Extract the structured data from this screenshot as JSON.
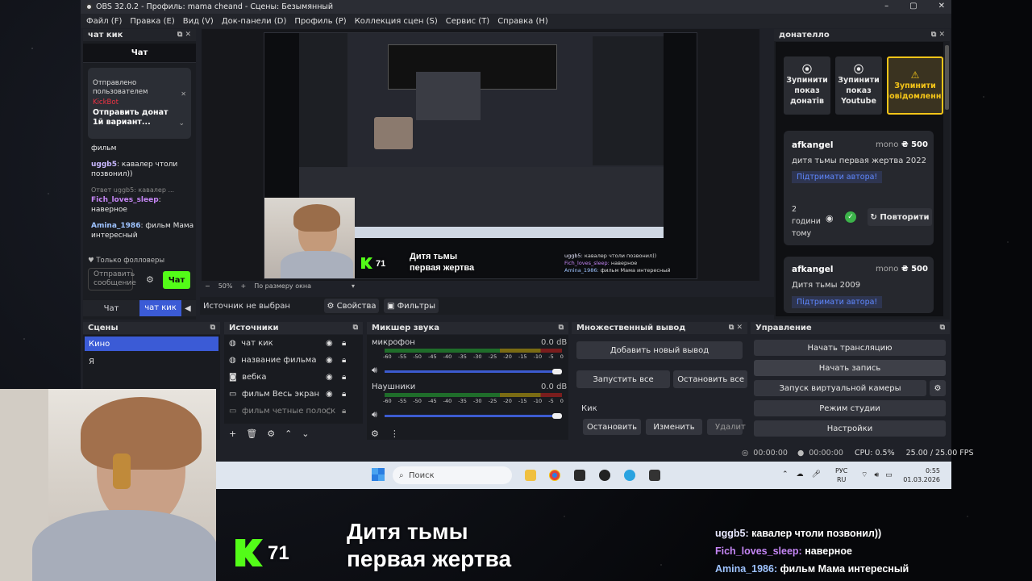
{
  "window": {
    "title": "OBS 32.0.2 - Профиль: mama cheand - Сцены: Безымянный",
    "controls": [
      "–",
      "▢",
      "✕"
    ]
  },
  "menu": [
    "Файл (F)",
    "Правка (E)",
    "Вид (V)",
    "Док-панели (D)",
    "Профиль (P)",
    "Коллекция сцен (S)",
    "Сервис (T)",
    "Справка (H)"
  ],
  "chat_dock": {
    "title": "чат кик",
    "header": "Чат",
    "pinned_label": "Отправлено пользователем",
    "pinned_user": "KickBot",
    "pinned_text": "Отправить донат 1й вариант...",
    "messages": [
      {
        "user": "",
        "text": "фильм"
      },
      {
        "user": "uggb5",
        "text": ": кавалер чтоли позвонил))"
      },
      {
        "reply": "Ответ uggb5: кавалер ...",
        "user": "Fich_loves_sleep",
        "text": ": наверное"
      },
      {
        "user": "Amina_1986",
        "text": ": фильм Мама интересный"
      }
    ],
    "followers_only": "Только фолловеры",
    "input_placeholder": "Отправить сообщение",
    "send_button": "Чат",
    "tabs": [
      "Чат",
      "чат кик"
    ]
  },
  "preview": {
    "zoom": "50%",
    "fit": "По размеру окна",
    "no_source": "Источник не выбран",
    "properties": "Свойства",
    "filters": "Фильтры",
    "overlay_count": "71",
    "overlay_title_1": "Дитя тьмы",
    "overlay_title_2": "первая жертва"
  },
  "donatello": {
    "title": "донателло",
    "buttons": [
      "Зупинити показ донатів",
      "Зупинити показ Youtube",
      "Зупинити повідомлення"
    ],
    "donations": [
      {
        "name": "afkangel",
        "method": "mono",
        "amount": "₴ 500",
        "message": "дитя тьмы первая жертва 2022",
        "support": "Підтримати автора!",
        "time": "2 години тому",
        "repeat": "Повторити"
      },
      {
        "name": "afkangel",
        "method": "mono",
        "amount": "₴ 500",
        "message": "Дитя тьмы 2009",
        "support": "Підтримати автора!"
      }
    ]
  },
  "scenes": {
    "title": "Сцены",
    "items": [
      "Кино",
      "Я"
    ]
  },
  "sources": {
    "title": "Источники",
    "items": [
      "чат кик",
      "название фильма",
      "вебка",
      "фильм Весь экран",
      "фильм четные полоск"
    ]
  },
  "mixer": {
    "title": "Микшер звука",
    "channels": [
      {
        "name": "микрофон",
        "db": "0.0 dB"
      },
      {
        "name": "Наушники",
        "db": "0.0 dB"
      }
    ],
    "ticks": [
      "-60",
      "-55",
      "-50",
      "-45",
      "-40",
      "-35",
      "-30",
      "-25",
      "-20",
      "-15",
      "-10",
      "-5",
      "0"
    ]
  },
  "multi_output": {
    "title": "Множественный вывод",
    "add": "Добавить новый вывод",
    "start_all": "Запустить все",
    "stop_all": "Остановить все",
    "target": "Кик",
    "stop": "Остановить",
    "edit": "Изменить",
    "delete": "Удалит"
  },
  "controls": {
    "title": "Управление",
    "start_stream": "Начать трансляцию",
    "start_record": "Начать запись",
    "virtual_cam": "Запуск виртуальной камеры",
    "studio": "Режим студии",
    "settings": "Настройки"
  },
  "status": {
    "stream_time": "00:00:00",
    "record_time": "00:00:00",
    "cpu": "CPU: 0.5%",
    "fps": "25.00 / 25.00 FPS"
  },
  "taskbar": {
    "search": "Поиск",
    "lang_1": "РУС",
    "lang_2": "RU",
    "time": "0:55",
    "date": "01.03.2026"
  },
  "bottom_overlay": {
    "count": "71",
    "title_1": "Дитя тьмы",
    "title_2": "первая жертва",
    "chat": [
      {
        "user": "uggb5:",
        "text": "кавалер чтоли позвонил))",
        "color": "#e8e8ff"
      },
      {
        "user": "Fich_loves_sleep:",
        "text": "наверное",
        "color": "#c586f5"
      },
      {
        "user": "Amina_1986:",
        "text": "фильм Мама интересный",
        "color": "#9ec3ff"
      }
    ]
  },
  "colors": {
    "kick_green": "#53fc18",
    "accent_blue": "#3b5bd6",
    "warn_yellow": "#f5c518"
  }
}
